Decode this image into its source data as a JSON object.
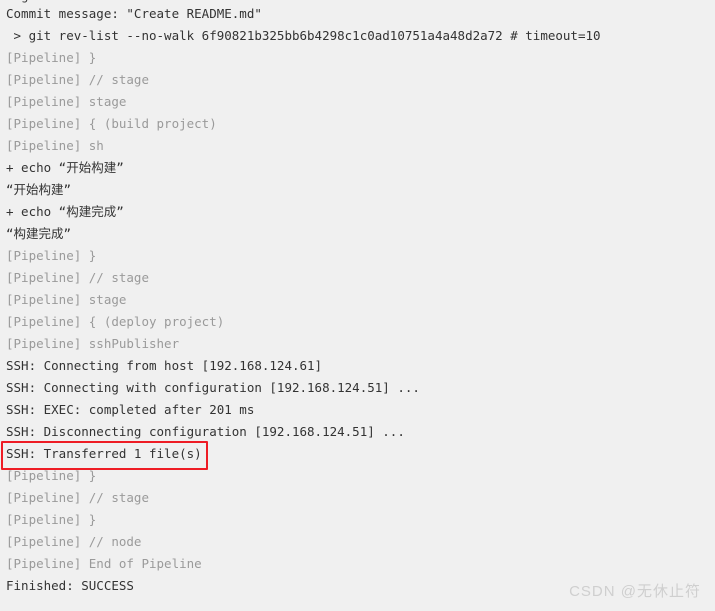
{
  "console": {
    "background_color": "#f0f0f0",
    "text_color": "#333333",
    "dim_text_color": "#9a9a9a",
    "clipped_top_line": "  g",
    "lines": [
      {
        "text": "Commit message: \"Create README.md\"",
        "style": "normal"
      },
      {
        "text": " > git rev-list --no-walk 6f90821b325bb6b4298c1c0ad10751a4a48d2a72 # timeout=10",
        "style": "normal"
      },
      {
        "text": "[Pipeline] }",
        "style": "dim"
      },
      {
        "text": "[Pipeline] // stage",
        "style": "dim"
      },
      {
        "text": "[Pipeline] stage",
        "style": "dim"
      },
      {
        "text": "[Pipeline] { (build project)",
        "style": "dim"
      },
      {
        "text": "[Pipeline] sh",
        "style": "dim"
      },
      {
        "text": "+ echo “开始构建”",
        "style": "cjk"
      },
      {
        "text": "“开始构建”",
        "style": "cjk"
      },
      {
        "text": "+ echo “构建完成”",
        "style": "cjk"
      },
      {
        "text": "“构建完成”",
        "style": "cjk"
      },
      {
        "text": "[Pipeline] }",
        "style": "dim"
      },
      {
        "text": "[Pipeline] // stage",
        "style": "dim"
      },
      {
        "text": "[Pipeline] stage",
        "style": "dim"
      },
      {
        "text": "[Pipeline] { (deploy project)",
        "style": "dim"
      },
      {
        "text": "[Pipeline] sshPublisher",
        "style": "dim"
      },
      {
        "text": "SSH: Connecting from host [192.168.124.61]",
        "style": "normal"
      },
      {
        "text": "SSH: Connecting with configuration [192.168.124.51] ...",
        "style": "normal"
      },
      {
        "text": "SSH: EXEC: completed after 201 ms",
        "style": "normal"
      },
      {
        "text": "SSH: Disconnecting configuration [192.168.124.51] ...",
        "style": "normal"
      },
      {
        "text": "SSH: Transferred 1 file(s)",
        "style": "normal"
      },
      {
        "text": "[Pipeline] }",
        "style": "dim"
      },
      {
        "text": "[Pipeline] // stage",
        "style": "dim"
      },
      {
        "text": "[Pipeline] }",
        "style": "dim"
      },
      {
        "text": "[Pipeline] // node",
        "style": "dim"
      },
      {
        "text": "[Pipeline] End of Pipeline",
        "style": "dim"
      },
      {
        "text": "Finished: SUCCESS",
        "style": "normal"
      }
    ]
  },
  "annotation": {
    "highlight_color": "#ee1c25",
    "target_line_index": 20,
    "target_text": "SSH: Transferred 1 file(s)"
  },
  "watermark": {
    "text": "CSDN @无休止符",
    "color": "#cfcfcf"
  }
}
